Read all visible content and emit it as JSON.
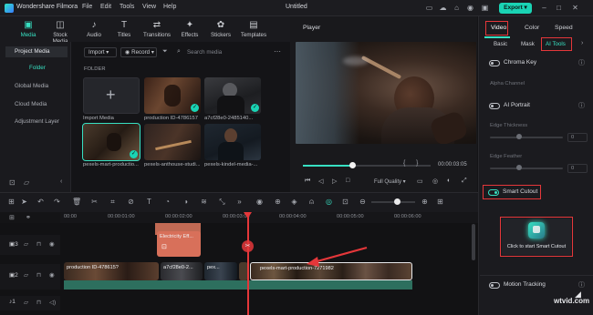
{
  "app": {
    "title": "Wondershare Filmora",
    "menus": [
      "File",
      "Edit",
      "Tools",
      "View",
      "Help"
    ],
    "project_name": "Untitled",
    "export_label": "Export"
  },
  "media_tabs": [
    {
      "label": "Media",
      "icon": "media-icon",
      "active": true
    },
    {
      "label": "Stock Media",
      "icon": "stock-media-icon"
    },
    {
      "label": "Audio",
      "icon": "audio-icon"
    },
    {
      "label": "Titles",
      "icon": "titles-icon"
    },
    {
      "label": "Transitions",
      "icon": "transitions-icon"
    },
    {
      "label": "Effects",
      "icon": "effects-icon"
    },
    {
      "label": "Stickers",
      "icon": "stickers-icon"
    },
    {
      "label": "Templates",
      "icon": "templates-icon"
    }
  ],
  "media_nav": {
    "items": [
      "Project Media",
      "Folder",
      "Global Media",
      "Cloud Media",
      "Adjustment Layer"
    ]
  },
  "media_toolbar": {
    "import_label": "Import",
    "record_label": "Record",
    "search_placeholder": "Search media"
  },
  "media_grid": {
    "folder_label": "FOLDER",
    "import_tile_label": "Import Media",
    "items": [
      {
        "label": "production ID-4786157",
        "checked": true
      },
      {
        "label": "a7cf28e0-2485140...",
        "checked": true
      },
      {
        "label": "pexels-mart-productio...",
        "checked": true,
        "selected": true
      },
      {
        "label": "pexels-anthouse-studi..."
      },
      {
        "label": "pexels-kindel-media-..."
      }
    ]
  },
  "player": {
    "title": "Player",
    "time": "00:00:03:05",
    "quality": "Full Quality"
  },
  "right_panel": {
    "tabs": [
      "Video",
      "Color",
      "Speed"
    ],
    "subtabs": [
      "Basic",
      "Mask",
      "AI Tools"
    ],
    "chroma_key": "Chroma Key",
    "alpha_channel": "Alpha Channel",
    "ai_portrait": "AI Portrait",
    "edge_thickness": "Edge Thickness",
    "edge_feather": "Edge Feather",
    "edge_thickness_value": "0",
    "edge_feather_value": "0",
    "smart_cutout": "Smart Cutout",
    "start_smart_cutout": "Click to start Smart Cutout",
    "motion_tracking": "Motion Tracking"
  },
  "timeline": {
    "ruler": [
      "00:00",
      "00:00:01:00",
      "00:00:02:00",
      "00:00:03:00",
      "00:00:04:00",
      "00:00:05:00",
      "00:00:06:00"
    ],
    "track_labels": [
      "3",
      "2",
      "1",
      "1"
    ],
    "title_clip": "Electricity Eff...",
    "video_clips": [
      "production ID-478615?",
      "a7cf28e0-2...",
      "pex...",
      "pexels-mart-production-7271982"
    ]
  },
  "watermark": "wtvid.com",
  "colors": {
    "accent": "#1ad3b4",
    "highlight": "#e5373a",
    "title_clip": "#e07a5f",
    "playhead": "#e5373a"
  }
}
